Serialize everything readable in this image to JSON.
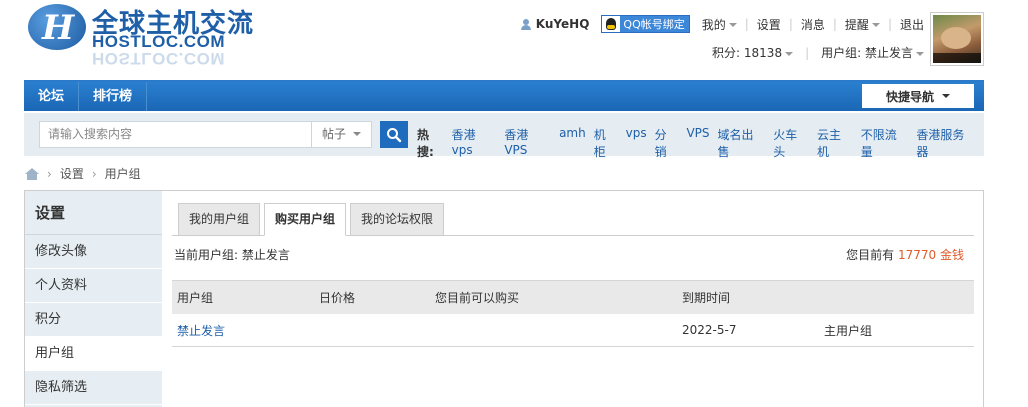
{
  "header": {
    "logo_cn": "全球主机交流",
    "logo_en": "HOSTLOC.COM",
    "username": "KuYeHQ",
    "qq_bind_label": "QQ帐号绑定",
    "menu": {
      "mine": "我的",
      "settings": "设置",
      "messages": "消息",
      "reminders": "提醒",
      "logout": "退出"
    },
    "points": "积分: 18138",
    "user_group": "用户组: 禁止发言"
  },
  "nav": {
    "items": [
      "论坛",
      "排行榜"
    ],
    "quick_nav": "快捷导航"
  },
  "search": {
    "placeholder": "请输入搜索内容",
    "type": "帖子",
    "hot_label": "热搜:",
    "hot_items": [
      "香港vps",
      "香港VPS",
      "amh",
      "机柜",
      "vps",
      "分销",
      "VPS",
      "域名出售",
      "火车头",
      "云主机",
      "不限流量",
      "香港服务器"
    ]
  },
  "breadcrumb": {
    "items": [
      "设置",
      "用户组"
    ]
  },
  "sidebar": {
    "title": "设置",
    "items": [
      {
        "label": "修改头像",
        "active": false
      },
      {
        "label": "个人资料",
        "active": false
      },
      {
        "label": "积分",
        "active": false
      },
      {
        "label": "用户组",
        "active": true
      },
      {
        "label": "隐私筛选",
        "active": false
      }
    ]
  },
  "content": {
    "tabs": [
      {
        "label": "我的用户组",
        "active": false
      },
      {
        "label": "购买用户组",
        "active": true
      },
      {
        "label": "我的论坛权限",
        "active": false
      }
    ],
    "current_group": "当前用户组: 禁止发言",
    "money_prefix": "您目前有",
    "money_value": "17770 金钱",
    "table": {
      "headers": [
        "用户组",
        "日价格",
        "您目前可以购买",
        "到期时间",
        ""
      ],
      "rows": [
        [
          "禁止发言",
          "",
          "",
          "2022-5-7",
          "主用户组"
        ]
      ]
    }
  },
  "colors": {
    "nav_blue": "#1a67b5",
    "link_blue": "#1e5fa8",
    "money_orange": "#e05a2a",
    "search_bg": "#e5edf2"
  }
}
